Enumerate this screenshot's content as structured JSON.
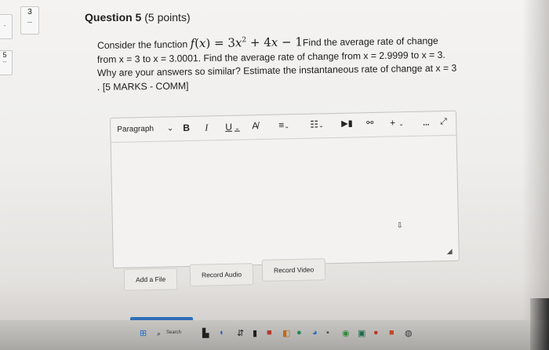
{
  "nav": {
    "current_tile": {
      "number": "3",
      "dash": "--"
    },
    "prev_tile": {
      "number": "5",
      "dash": "--"
    },
    "left_dash_top": "-"
  },
  "question": {
    "title": "Question 5",
    "points": "(5 points)",
    "lead": "Consider the function",
    "function_text": "f(x) = 3x² + 4x − 1",
    "line1_tail": "Find the average rate of change",
    "line2": "from x = 3 to x = 3.0001.  Find the average rate of change from x = 2.9999 to x = 3.",
    "line3": "Why are your answers so similar? Estimate the instantaneous rate of change at x = 3",
    "line4": ". [5 MARKS - COMM]"
  },
  "editor": {
    "paragraph_label": "Paragraph",
    "bold": "B",
    "italic": "I",
    "underline": "U",
    "more": "...",
    "plus": "+"
  },
  "buttons": {
    "add_file": "Add a File",
    "record_audio": "Record Audio",
    "record_video": "Record Video"
  },
  "taskbar": {
    "search_label": "Search"
  }
}
